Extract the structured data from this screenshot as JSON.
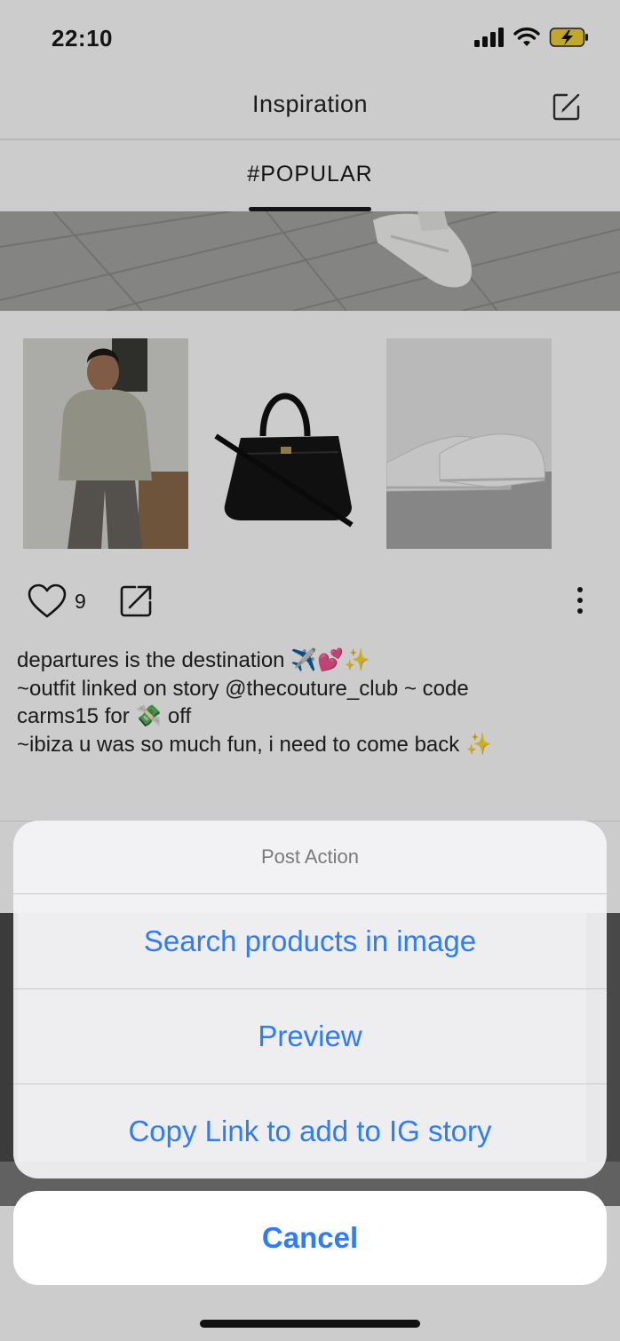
{
  "status_bar": {
    "time": "22:10",
    "icons": [
      "cellular-signal-icon",
      "wifi-icon",
      "battery-charging-icon"
    ]
  },
  "header": {
    "title": "Inspiration",
    "edit_icon": "edit-square-icon"
  },
  "tabs": [
    {
      "label": "#POPULAR",
      "active": true
    }
  ],
  "post": {
    "products": [
      {
        "label": "Product thumbnail - grey hoodie outfit"
      },
      {
        "label": "Product thumbnail - black croc bag"
      },
      {
        "label": "Product thumbnail - white sneakers"
      }
    ],
    "likes": "9",
    "caption_lines": [
      "departures is the destination ✈️💕✨",
      "~outfit linked on story @thecouture_club ~ code",
      "carms15 for 💸 off",
      "~ibiza u was so much fun, i need to come back ✨"
    ]
  },
  "action_sheet": {
    "title": "Post Action",
    "options": [
      "Search products in image",
      "Preview",
      "Copy Link to add to IG story"
    ],
    "cancel": "Cancel"
  },
  "colors": {
    "accent": "#2e7cf6",
    "dim_overlay": "rgba(0,0,0,0.2)"
  }
}
